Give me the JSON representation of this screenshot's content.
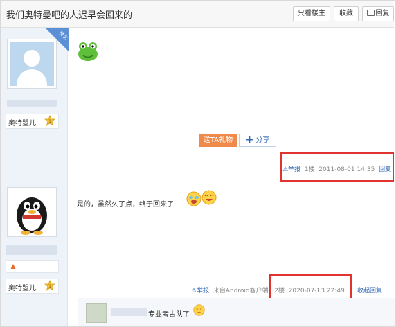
{
  "thread": {
    "title": "我们奥特曼吧的人迟早会回来的",
    "buttons": {
      "only_op": "只看楼主",
      "favorite": "收藏",
      "reply": "回复"
    }
  },
  "posts": [
    {
      "author": "奥特曌儿",
      "op_tag": "楼主",
      "actions": {
        "gift": "送TA礼物",
        "share": "分享"
      },
      "meta": {
        "report": "举报",
        "floor": "1楼",
        "time": "2011-08-01 14:35",
        "reply": "回复"
      }
    },
    {
      "author": "奥特曌儿",
      "content": "是的，虽然久了点，终于回来了",
      "meta": {
        "report": "举报",
        "source": "来自Android客户端",
        "floor": "2楼",
        "time": "2020-07-13 22:49",
        "collapse": "收起回复"
      },
      "sub_reply": {
        "text": "专业考古队了"
      }
    }
  ],
  "colors": {
    "highlight": "#e0332f",
    "link": "#2d64b3",
    "gift": "#f08a4b"
  },
  "icons": [
    "frog-emoji-icon",
    "crying-emoji-icon",
    "laughing-emoji-icon",
    "sweat-emoji-icon",
    "level-badge-icon",
    "warning-icon"
  ]
}
